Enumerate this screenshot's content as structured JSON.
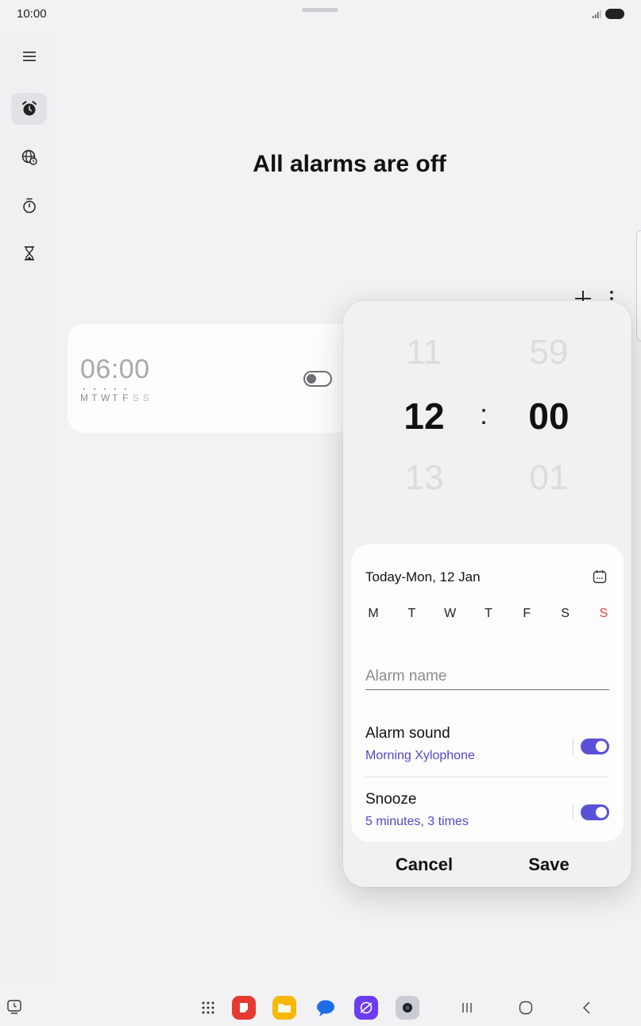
{
  "status_bar": {
    "time": "10:00"
  },
  "nav_rail": {
    "items": [
      {
        "name": "menu",
        "icon": "menu-icon"
      },
      {
        "name": "alarm",
        "icon": "alarm-clock-icon",
        "active": true
      },
      {
        "name": "world-clock",
        "icon": "globe-clock-icon"
      },
      {
        "name": "stopwatch",
        "icon": "stopwatch-icon"
      },
      {
        "name": "timer",
        "icon": "hourglass-icon"
      }
    ]
  },
  "main": {
    "title": "All alarms are off",
    "alarm": {
      "time": "06:00",
      "days": [
        {
          "letter": "M",
          "on": true
        },
        {
          "letter": "T",
          "on": true
        },
        {
          "letter": "W",
          "on": true
        },
        {
          "letter": "T",
          "on": true
        },
        {
          "letter": "F",
          "on": true
        },
        {
          "letter": "S",
          "on": false
        },
        {
          "letter": "S",
          "on": false
        }
      ],
      "enabled": false
    }
  },
  "editor": {
    "hours": {
      "prev": "11",
      "selected": "12",
      "next": "13"
    },
    "separator": ":",
    "minutes": {
      "prev": "59",
      "selected": "00",
      "next": "01"
    },
    "date_label": "Today-Mon, 12 Jan",
    "weekdays": [
      "M",
      "T",
      "W",
      "T",
      "F",
      "S",
      "S"
    ],
    "alarm_name_placeholder": "Alarm name",
    "alarm_sound": {
      "title": "Alarm sound",
      "value": "Morning Xylophone",
      "enabled": true
    },
    "snooze": {
      "title": "Snooze",
      "value": "5 minutes, 3 times",
      "enabled": true
    },
    "cancel_label": "Cancel",
    "save_label": "Save",
    "accent_color": "#5b51d6",
    "sunday_color": "#e2443c"
  },
  "taskbar": {
    "apps": [
      "app-drawer-icon",
      "notes-app-icon",
      "my-files-icon",
      "messages-icon",
      "browser-icon",
      "camera-icon"
    ],
    "nav_keys": [
      "recents-icon",
      "home-icon",
      "back-icon"
    ]
  }
}
